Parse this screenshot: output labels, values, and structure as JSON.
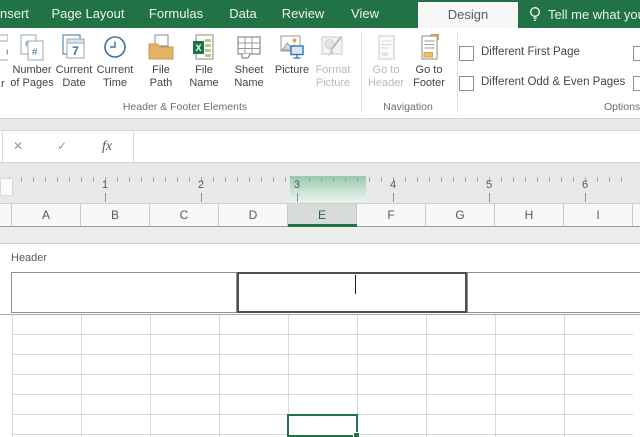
{
  "tab_bar": {
    "tabs": [
      {
        "label": "nsert"
      },
      {
        "label": "Page Layout"
      },
      {
        "label": "Formulas"
      },
      {
        "label": "Data"
      },
      {
        "label": "Review"
      },
      {
        "label": "View"
      },
      {
        "label": "Design"
      }
    ],
    "active_tab": "Design",
    "tell_me_label": "Tell me what you"
  },
  "ribbon": {
    "buttons": [
      {
        "id": "page-number-partial",
        "label_line1": "",
        "label_line2": "r",
        "disabled": false
      },
      {
        "id": "number-of-pages",
        "label_line1": "Number",
        "label_line2": "of Pages",
        "disabled": false
      },
      {
        "id": "current-date",
        "label_line1": "Current",
        "label_line2": "Date",
        "disabled": false
      },
      {
        "id": "current-time",
        "label_line1": "Current",
        "label_line2": "Time",
        "disabled": false
      },
      {
        "id": "file-path",
        "label_line1": "File",
        "label_line2": "Path",
        "disabled": false
      },
      {
        "id": "file-name",
        "label_line1": "File",
        "label_line2": "Name",
        "disabled": false
      },
      {
        "id": "sheet-name",
        "label_line1": "Sheet",
        "label_line2": "Name",
        "disabled": false
      },
      {
        "id": "picture",
        "label_line1": "Picture",
        "label_line2": "",
        "disabled": false
      },
      {
        "id": "format-picture",
        "label_line1": "Format",
        "label_line2": "Picture",
        "disabled": true
      },
      {
        "id": "go-to-header",
        "label_line1": "Go to",
        "label_line2": "Header",
        "disabled": true
      },
      {
        "id": "go-to-footer",
        "label_line1": "Go to",
        "label_line2": "Footer",
        "disabled": false
      }
    ],
    "group_labels": [
      "Header & Footer Elements",
      "Navigation",
      "Options"
    ],
    "checkboxes": [
      {
        "label": "Different First Page",
        "checked": false
      },
      {
        "label": "Different Odd & Even Pages",
        "checked": false
      }
    ]
  },
  "formula_bar": {
    "cancel_glyph": "✕",
    "enter_glyph": "✓",
    "function_glyph": "fx",
    "value": ""
  },
  "ruler": {
    "unit_marks": [
      "1",
      "2",
      "3",
      "4",
      "5",
      "6"
    ]
  },
  "sheet": {
    "column_headers": [
      "A",
      "B",
      "C",
      "D",
      "E",
      "F",
      "G",
      "H",
      "I"
    ],
    "selected_column": "E",
    "header_zone_label": "Header",
    "header_sections": {
      "left": "",
      "center": "",
      "right": ""
    }
  },
  "colors": {
    "excel_green": "#217346",
    "selection_border": "#217346",
    "ruler_highlight_green": "#9cc7ad",
    "selected_column_header_bg": "#d8dcd9"
  }
}
